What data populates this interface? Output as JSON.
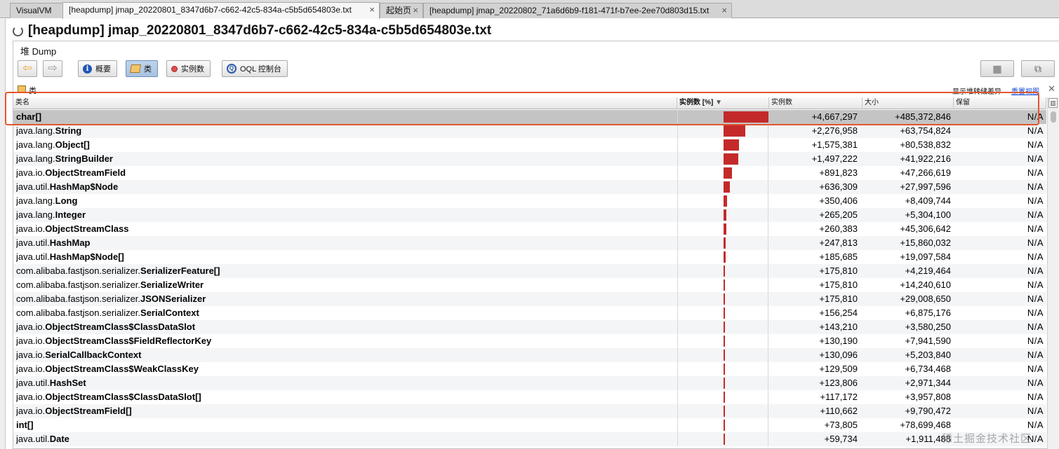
{
  "tabs": [
    {
      "label": "VisualVM",
      "active": false,
      "closable": false
    },
    {
      "label": "[heapdump] jmap_20220801_8347d6b7-c662-42c5-834a-c5b5d654803e.txt",
      "active": true,
      "closable": true
    },
    {
      "label": "起始页",
      "active": false,
      "closable": true
    },
    {
      "label": "[heapdump] jmap_20220802_71a6d6b9-f181-471f-b7ee-2ee70d803d15.txt",
      "active": false,
      "closable": true
    }
  ],
  "page_title": "[heapdump] jmap_20220801_8347d6b7-c662-42c5-834a-c5b5d654803e.txt",
  "subtitle": "堆 Dump",
  "toolbar": {
    "summary_label": "概要",
    "classes_label": "类",
    "instances_label": "实例数",
    "oql_label": "OQL 控制台"
  },
  "section": {
    "title": "类",
    "show_diff": "显示堆转储差异",
    "reset_view": "重置视图",
    "close_glyph": "✕"
  },
  "table": {
    "headers": {
      "name": "类名",
      "instances_pct": "实例数 [%]",
      "instances": "实例数",
      "size": "大小",
      "retained": "保留"
    },
    "rows": [
      {
        "pkg": "",
        "cls": "char[]",
        "pct": 100,
        "count": "+4,667,297",
        "size": "+485,372,846",
        "retained": "N/A"
      },
      {
        "pkg": "java.lang.",
        "cls": "String",
        "pct": 48.8,
        "count": "+2,276,958",
        "size": "+63,754,824",
        "retained": "N/A"
      },
      {
        "pkg": "java.lang.",
        "cls": "Object[]",
        "pct": 33.8,
        "count": "+1,575,381",
        "size": "+80,538,832",
        "retained": "N/A"
      },
      {
        "pkg": "java.lang.",
        "cls": "StringBuilder",
        "pct": 32.1,
        "count": "+1,497,222",
        "size": "+41,922,216",
        "retained": "N/A"
      },
      {
        "pkg": "java.io.",
        "cls": "ObjectStreamField",
        "pct": 19.1,
        "count": "+891,823",
        "size": "+47,266,619",
        "retained": "N/A"
      },
      {
        "pkg": "java.util.",
        "cls": "HashMap$Node",
        "pct": 13.6,
        "count": "+636,309",
        "size": "+27,997,596",
        "retained": "N/A"
      },
      {
        "pkg": "java.lang.",
        "cls": "Long",
        "pct": 7.5,
        "count": "+350,406",
        "size": "+8,409,744",
        "retained": "N/A"
      },
      {
        "pkg": "java.lang.",
        "cls": "Integer",
        "pct": 5.7,
        "count": "+265,205",
        "size": "+5,304,100",
        "retained": "N/A"
      },
      {
        "pkg": "java.io.",
        "cls": "ObjectStreamClass",
        "pct": 5.6,
        "count": "+260,383",
        "size": "+45,306,642",
        "retained": "N/A"
      },
      {
        "pkg": "java.util.",
        "cls": "HashMap",
        "pct": 5.3,
        "count": "+247,813",
        "size": "+15,860,032",
        "retained": "N/A"
      },
      {
        "pkg": "java.util.",
        "cls": "HashMap$Node[]",
        "pct": 4.0,
        "count": "+185,685",
        "size": "+19,097,584",
        "retained": "N/A"
      },
      {
        "pkg": "com.alibaba.fastjson.serializer.",
        "cls": "SerializerFeature[]",
        "pct": 3.8,
        "count": "+175,810",
        "size": "+4,219,464",
        "retained": "N/A"
      },
      {
        "pkg": "com.alibaba.fastjson.serializer.",
        "cls": "SerializeWriter",
        "pct": 3.8,
        "count": "+175,810",
        "size": "+14,240,610",
        "retained": "N/A"
      },
      {
        "pkg": "com.alibaba.fastjson.serializer.",
        "cls": "JSONSerializer",
        "pct": 3.8,
        "count": "+175,810",
        "size": "+29,008,650",
        "retained": "N/A"
      },
      {
        "pkg": "com.alibaba.fastjson.serializer.",
        "cls": "SerialContext",
        "pct": 3.3,
        "count": "+156,254",
        "size": "+6,875,176",
        "retained": "N/A"
      },
      {
        "pkg": "java.io.",
        "cls": "ObjectStreamClass$ClassDataSlot",
        "pct": 3.1,
        "count": "+143,210",
        "size": "+3,580,250",
        "retained": "N/A"
      },
      {
        "pkg": "java.io.",
        "cls": "ObjectStreamClass$FieldReflectorKey",
        "pct": 2.8,
        "count": "+130,190",
        "size": "+7,941,590",
        "retained": "N/A"
      },
      {
        "pkg": "java.io.",
        "cls": "SerialCallbackContext",
        "pct": 2.8,
        "count": "+130,096",
        "size": "+5,203,840",
        "retained": "N/A"
      },
      {
        "pkg": "java.io.",
        "cls": "ObjectStreamClass$WeakClassKey",
        "pct": 2.8,
        "count": "+129,509",
        "size": "+6,734,468",
        "retained": "N/A"
      },
      {
        "pkg": "java.util.",
        "cls": "HashSet",
        "pct": 2.7,
        "count": "+123,806",
        "size": "+2,971,344",
        "retained": "N/A"
      },
      {
        "pkg": "java.io.",
        "cls": "ObjectStreamClass$ClassDataSlot[]",
        "pct": 2.5,
        "count": "+117,172",
        "size": "+3,957,808",
        "retained": "N/A"
      },
      {
        "pkg": "java.io.",
        "cls": "ObjectStreamField[]",
        "pct": 2.4,
        "count": "+110,662",
        "size": "+9,790,472",
        "retained": "N/A"
      },
      {
        "pkg": "",
        "cls": "int[]",
        "pct": 1.6,
        "count": "+73,805",
        "size": "+78,699,468",
        "retained": "N/A"
      },
      {
        "pkg": "java.util.",
        "cls": "Date",
        "pct": 1.3,
        "count": "+59,734",
        "size": "+1,911,488",
        "retained": "N/A"
      }
    ]
  },
  "colors": {
    "bar": "#c42a2a",
    "highlight": "#e2562f",
    "selected_row": "#c4c4c4"
  },
  "watermark": "稀土掘金技术社区"
}
